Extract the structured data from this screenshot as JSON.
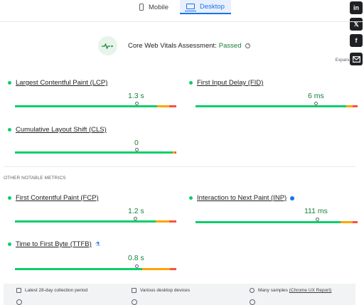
{
  "tabs": {
    "mobile": "Mobile",
    "desktop": "Desktop"
  },
  "assessment": {
    "label": "Core Web Vitals Assessment:",
    "status": "Passed",
    "expand": "Expand vi"
  },
  "metrics": {
    "lcp": {
      "title": "Largest Contentful Paint (LCP)",
      "value": "1.3 s",
      "split": [
        0.82,
        0.07,
        0.04
      ]
    },
    "fid": {
      "title": "First Input Delay (FID)",
      "value": "6 ms",
      "split": [
        0.93,
        0.04,
        0.03
      ]
    },
    "cls": {
      "title": "Cumulative Layout Shift (CLS)",
      "value": "0",
      "split": [
        0.98,
        0.01,
        0.01
      ]
    },
    "fcp": {
      "title": "First Contentful Paint (FCP)",
      "value": "1.2 s",
      "split": [
        0.82,
        0.08,
        0.04
      ]
    },
    "inp": {
      "title": "Interaction to Next Paint (INP)",
      "value": "111 ms",
      "split": [
        0.87,
        0.07,
        0.03
      ]
    },
    "ttfb": {
      "title": "Time to First Byte (TTFB)",
      "value": "0.8 s",
      "split": [
        0.78,
        0.17,
        0.04
      ]
    }
  },
  "sections": {
    "other": "OTHER NOTABLE METRICS"
  },
  "footer": {
    "period": "Latest 28-day collection period",
    "devices": "Various desktop devices",
    "samples": "Many samples",
    "source": "(Chrome UX Report)"
  },
  "social": {
    "linkedin": "in",
    "x": "𝕏",
    "facebook": "f"
  },
  "colors": {
    "good": "#0cce6b",
    "needs_improvement": "#ffa400",
    "poor": "#ff4e42",
    "accent": "#1a73e8"
  }
}
